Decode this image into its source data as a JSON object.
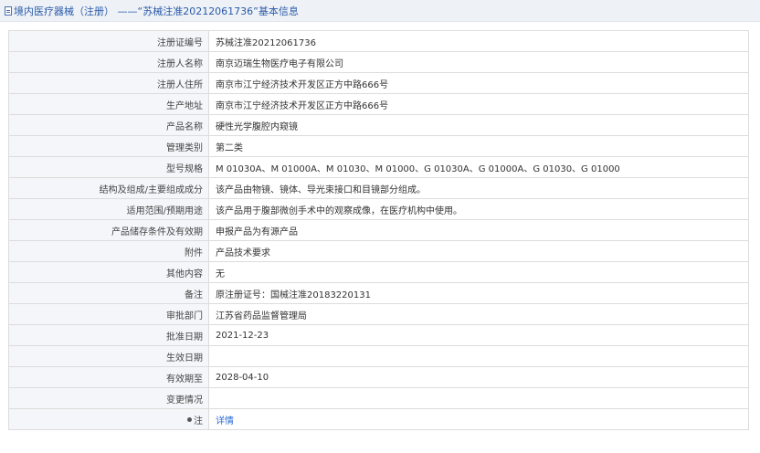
{
  "header": {
    "title": "境内医疗器械（注册） ——“苏械注准20212061736”基本信息"
  },
  "rows": [
    {
      "label": "注册证编号",
      "value": "苏械注准20212061736"
    },
    {
      "label": "注册人名称",
      "value": "南京迈瑞生物医疗电子有限公司"
    },
    {
      "label": "注册人住所",
      "value": "南京市江宁经济技术开发区正方中路666号"
    },
    {
      "label": "生产地址",
      "value": "南京市江宁经济技术开发区正方中路666号"
    },
    {
      "label": "产品名称",
      "value": "硬性光学腹腔内窥镜"
    },
    {
      "label": "管理类别",
      "value": "第二类"
    },
    {
      "label": "型号规格",
      "value": "M 01030A、M 01000A、M 01030、M 01000、G 01030A、G 01000A、G 01030、G 01000"
    },
    {
      "label": "结构及组成/主要组成成分",
      "value": "该产品由物镜、镜体、导光束接口和目镜部分组成。"
    },
    {
      "label": "适用范围/预期用途",
      "value": "该产品用于腹部微创手术中的观察成像，在医疗机构中使用。"
    },
    {
      "label": "产品储存条件及有效期",
      "value": "申报产品为有源产品"
    },
    {
      "label": "附件",
      "value": "产品技术要求"
    },
    {
      "label": "其他内容",
      "value": "无"
    },
    {
      "label": "备注",
      "value": "原注册证号：国械注准20183220131"
    },
    {
      "label": "审批部门",
      "value": "江苏省药品监督管理局"
    },
    {
      "label": "批准日期",
      "value": "2021-12-23"
    },
    {
      "label": "生效日期",
      "value": ""
    },
    {
      "label": "有效期至",
      "value": "2028-04-10"
    },
    {
      "label": "变更情况",
      "value": ""
    }
  ],
  "note": {
    "label": "注",
    "link": "详情"
  }
}
